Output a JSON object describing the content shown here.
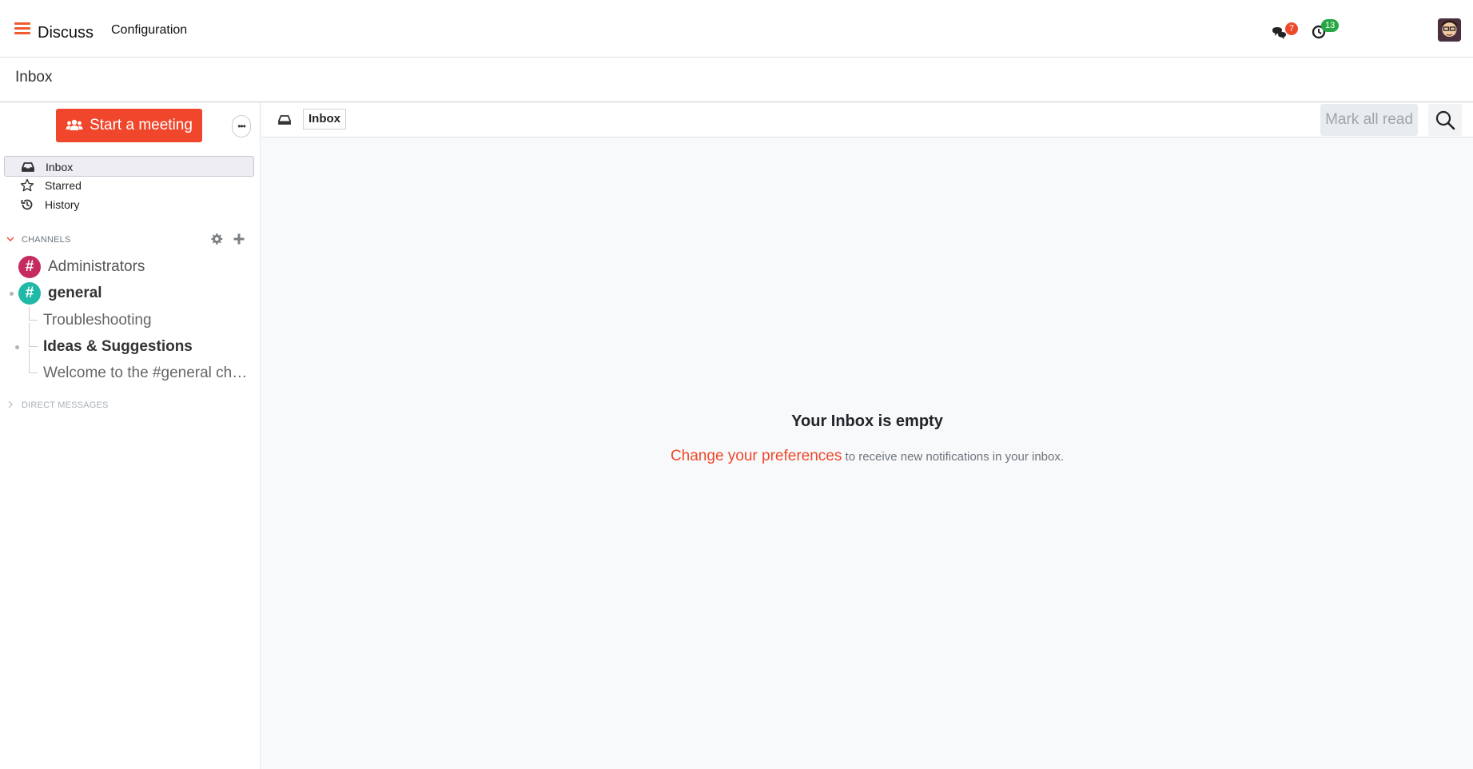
{
  "navbar": {
    "app_name": "Discuss",
    "menu_configuration": "Configuration",
    "messages_count": "7",
    "activities_count": "13"
  },
  "breadcrumb": {
    "current": "Inbox"
  },
  "sidebar": {
    "start_meeting_label": "Start a meeting",
    "mailboxes": [
      {
        "label": "Inbox",
        "icon": "inbox-icon",
        "active": true
      },
      {
        "label": "Starred",
        "icon": "star-icon",
        "active": false
      },
      {
        "label": "History",
        "icon": "history-icon",
        "active": false
      }
    ],
    "channels_header": "CHANNELS",
    "channels": [
      {
        "label": "Administrators",
        "color": "#c52b5f"
      },
      {
        "label": "general",
        "color": "#20b8a6"
      }
    ],
    "threads": [
      {
        "label": "Troubleshooting"
      },
      {
        "label": "Ideas & Suggestions"
      },
      {
        "label": "Welcome to the #general channel"
      }
    ],
    "dm_header": "DIRECT MESSAGES"
  },
  "main": {
    "thread_name": "Inbox",
    "mark_all_read": "Mark all read",
    "empty_title": "Your Inbox is empty",
    "empty_link": "Change your preferences",
    "empty_text": " to receive new notifications in your inbox."
  },
  "colors": {
    "brand": "#f0472c",
    "badge_red": "#ec4a2c",
    "badge_green": "#28a745"
  }
}
